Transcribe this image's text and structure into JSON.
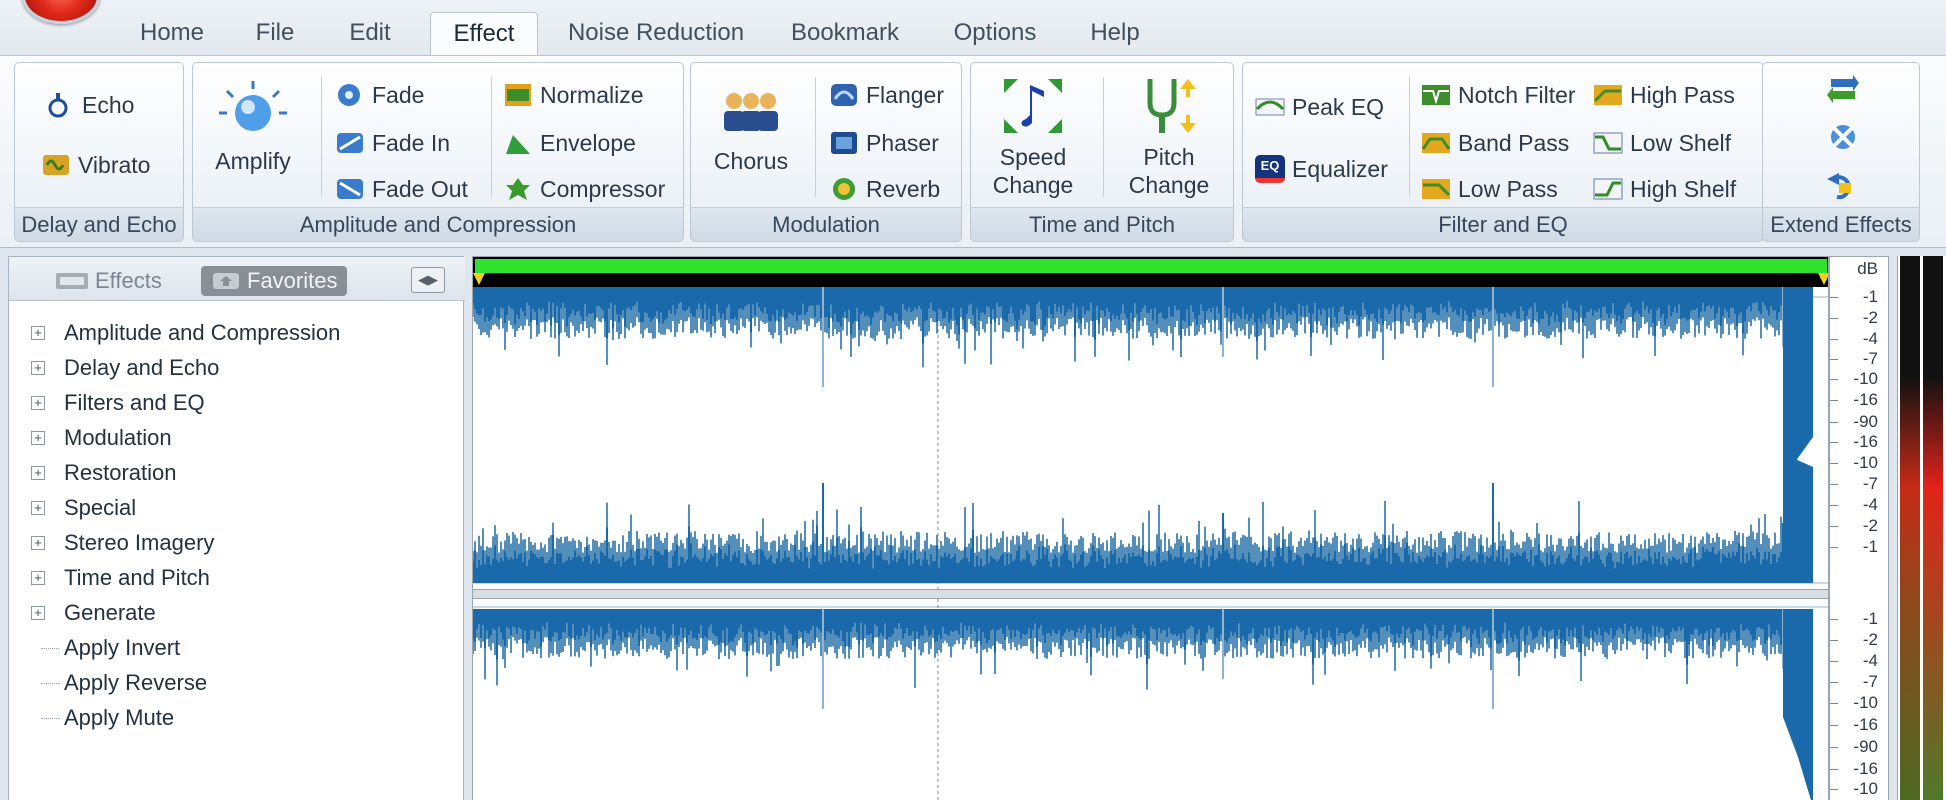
{
  "tabs": [
    {
      "label": "Home",
      "active": false
    },
    {
      "label": "File",
      "active": false
    },
    {
      "label": "Edit",
      "active": false
    },
    {
      "label": "Effect",
      "active": true
    },
    {
      "label": "Noise Reduction",
      "active": false
    },
    {
      "label": "Bookmark",
      "active": false
    },
    {
      "label": "Options",
      "active": false
    },
    {
      "label": "Help",
      "active": false
    }
  ],
  "ribbon": {
    "delay_echo": {
      "label": "Delay and Echo",
      "echo": "Echo",
      "vibrato": "Vibrato"
    },
    "amplitude": {
      "label": "Amplitude and Compression",
      "amplify": "Amplify",
      "fade": "Fade",
      "fade_in": "Fade In",
      "fade_out": "Fade Out",
      "normalize": "Normalize",
      "envelope": "Envelope",
      "compressor": "Compressor"
    },
    "modulation": {
      "label": "Modulation",
      "chorus": "Chorus",
      "flanger": "Flanger",
      "phaser": "Phaser",
      "reverb": "Reverb"
    },
    "time_pitch": {
      "label": "Time and Pitch",
      "speed_1": "Speed",
      "speed_2": "Change",
      "pitch_1": "Pitch",
      "pitch_2": "Change"
    },
    "filter_eq": {
      "label": "Filter and EQ",
      "peak_eq": "Peak EQ",
      "equalizer": "Equalizer",
      "eq_badge": "EQ",
      "notch": "Notch Filter",
      "band_pass": "Band Pass",
      "low_pass": "Low Pass",
      "high_pass": "High Pass",
      "low_shelf": "Low Shelf",
      "high_shelf": "High Shelf"
    },
    "extend": {
      "label": "Extend Effects"
    }
  },
  "panel": {
    "tabs": {
      "effects": "Effects",
      "favorites": "Favorites",
      "selected": "favorites"
    },
    "tree": [
      {
        "label": "Amplitude and Compression",
        "expandable": true
      },
      {
        "label": "Delay and Echo",
        "expandable": true
      },
      {
        "label": "Filters and EQ",
        "expandable": true
      },
      {
        "label": "Modulation",
        "expandable": true
      },
      {
        "label": "Restoration",
        "expandable": true
      },
      {
        "label": "Special",
        "expandable": true
      },
      {
        "label": "Stereo Imagery",
        "expandable": true
      },
      {
        "label": "Time and Pitch",
        "expandable": true
      },
      {
        "label": "Generate",
        "expandable": true
      },
      {
        "label": "Apply Invert",
        "expandable": false
      },
      {
        "label": "Apply Reverse",
        "expandable": false
      },
      {
        "label": "Apply Mute",
        "expandable": false
      }
    ]
  },
  "db_scale": {
    "unit": "dB",
    "ch1": [
      "-1",
      "-2",
      "-4",
      "-7",
      "-10",
      "-16",
      "-90",
      "-16",
      "-10",
      "-7",
      "-4",
      "-2",
      "-1"
    ],
    "ch2": [
      "-1",
      "-2",
      "-4",
      "-7",
      "-10",
      "-16",
      "-90",
      "-16",
      "-10"
    ]
  },
  "colors": {
    "wave": "#1a6aab",
    "wave_light": "#8fb4cc",
    "progress": "#2ee22e",
    "meter_top": "#1a1a1a",
    "meter_red": "#e3221a",
    "meter_green": "#4c7a2a"
  }
}
